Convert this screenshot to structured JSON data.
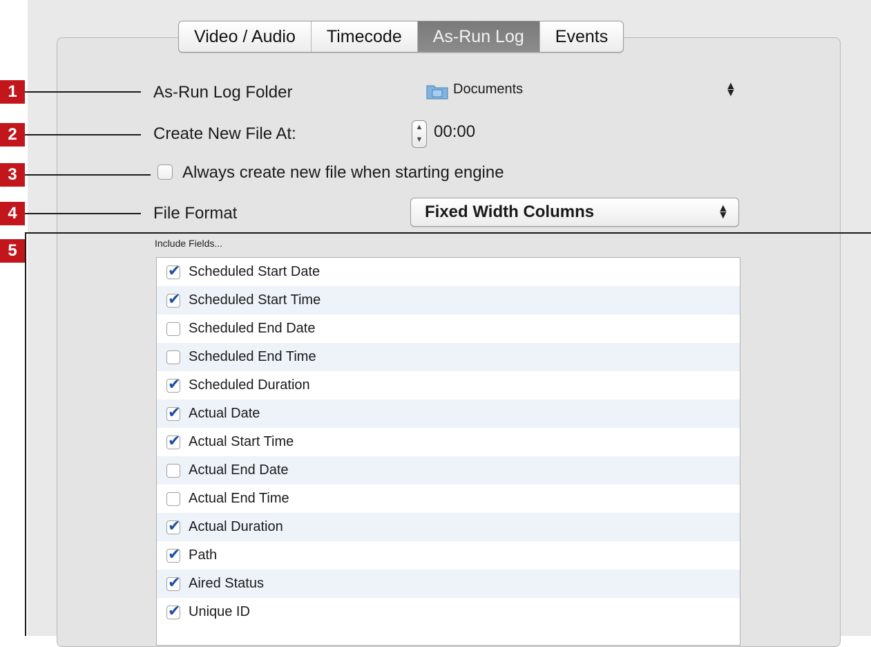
{
  "tabs": [
    {
      "label": "Video / Audio",
      "active": false
    },
    {
      "label": "Timecode",
      "active": false
    },
    {
      "label": "As-Run Log",
      "active": true
    },
    {
      "label": "Events",
      "active": false
    }
  ],
  "markers": [
    "1",
    "2",
    "3",
    "4",
    "5"
  ],
  "log_folder": {
    "label": "As-Run Log Folder",
    "value": "Documents"
  },
  "new_file": {
    "label": "Create New File At:",
    "value": "00:00"
  },
  "always_new": {
    "label": "Always create new file when starting engine",
    "checked": false
  },
  "file_format": {
    "label": "File Format",
    "value": "Fixed Width Columns"
  },
  "include_fields": {
    "label": "Include Fields...",
    "items": [
      {
        "label": "Scheduled Start Date",
        "checked": true
      },
      {
        "label": "Scheduled Start Time",
        "checked": true
      },
      {
        "label": "Scheduled End Date",
        "checked": false
      },
      {
        "label": "Scheduled End Time",
        "checked": false
      },
      {
        "label": "Scheduled Duration",
        "checked": true
      },
      {
        "label": "Actual Date",
        "checked": true
      },
      {
        "label": "Actual Start Time",
        "checked": true
      },
      {
        "label": "Actual End Date",
        "checked": false
      },
      {
        "label": "Actual End Time",
        "checked": false
      },
      {
        "label": "Actual Duration",
        "checked": true
      },
      {
        "label": "Path",
        "checked": true
      },
      {
        "label": "Aired Status",
        "checked": true
      },
      {
        "label": "Unique ID",
        "checked": true
      }
    ]
  },
  "colors": {
    "marker": "#c3151c",
    "active_tab": "#818181",
    "check": "#1f4fa0",
    "alt_row": "#eef3fa"
  }
}
